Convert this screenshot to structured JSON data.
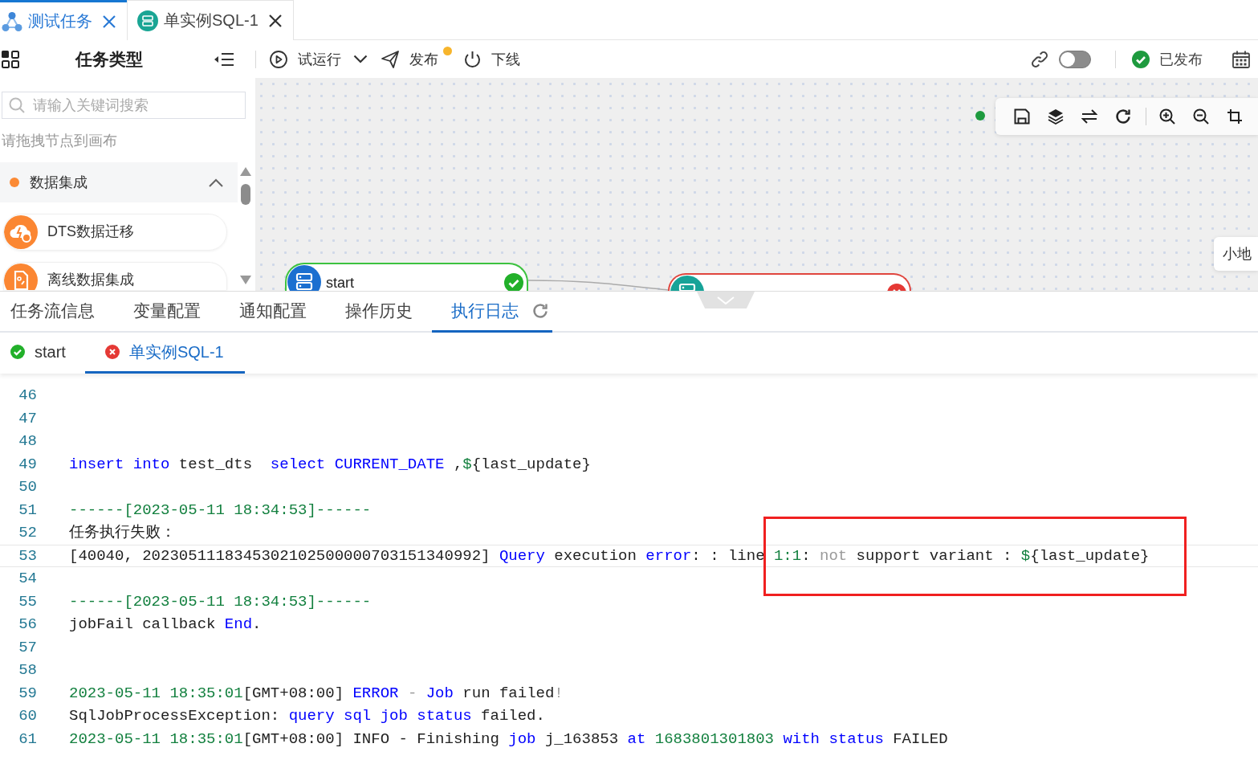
{
  "tabs": [
    {
      "label": "测试任务",
      "kind": "flow",
      "selected": true
    },
    {
      "label": "单实例SQL-1",
      "kind": "sql",
      "selected": false
    }
  ],
  "toolbar": {
    "title": "任务类型",
    "actions": [
      {
        "label": "试运行",
        "kind": "run",
        "dropdown": true,
        "dot": false
      },
      {
        "label": "发布",
        "kind": "publish",
        "dropdown": false,
        "dot": true
      },
      {
        "label": "下线",
        "kind": "offline",
        "dropdown": false,
        "dot": false
      }
    ],
    "toggle": {
      "on": false
    },
    "status": {
      "label": "已发布",
      "kind": "published"
    }
  },
  "sidebar": {
    "search": {
      "placeholder": "请输入关键词搜索"
    },
    "hint": "请拖拽节点到画布",
    "categories": [
      {
        "label": "数据集成",
        "expanded": true,
        "items": [
          {
            "label": "DTS数据迁移",
            "kind": "dts"
          },
          {
            "label": "离线数据集成",
            "kind": "offline"
          }
        ]
      }
    ]
  },
  "canvas": {
    "nodes": [
      {
        "label": "start",
        "kind": "success"
      },
      {
        "kind": "failed"
      }
    ],
    "minimap": {
      "label": "小地"
    }
  },
  "panel": {
    "tabs": [
      {
        "label": "任务流信息",
        "selected": false,
        "refresh": false
      },
      {
        "label": "变量配置",
        "selected": false,
        "refresh": false
      },
      {
        "label": "通知配置",
        "selected": false,
        "refresh": false
      },
      {
        "label": "操作历史",
        "selected": false,
        "refresh": false
      },
      {
        "label": "执行日志",
        "selected": true,
        "refresh": true
      }
    ],
    "node_tabs": [
      {
        "label": "start",
        "kind": "success",
        "selected": false
      },
      {
        "label": "单实例SQL-1",
        "kind": "failed",
        "selected": true
      }
    ],
    "log": {
      "lines": [
        {
          "number": "46",
          "active": false
        },
        {
          "number": "47",
          "active": false
        },
        {
          "number": "48",
          "active": false
        },
        {
          "number": "49",
          "active": false,
          "tokens": [
            {
              "text": "insert into",
              "kind": "keyword"
            },
            {
              "text": " test_dts  ",
              "kind": "plain"
            },
            {
              "text": "select CURRENT_DATE",
              "kind": "keyword"
            },
            {
              "text": " ,",
              "kind": "plain"
            },
            {
              "text": "$",
              "kind": "literal"
            },
            {
              "text": "{last_update}",
              "kind": "plain"
            }
          ]
        },
        {
          "number": "50",
          "active": false
        },
        {
          "number": "51",
          "active": false,
          "tokens": [
            {
              "text": "------[2023-05-11 18:34:53]------",
              "kind": "literal"
            }
          ]
        },
        {
          "number": "52",
          "active": false,
          "tokens": [
            {
              "text": "任务执行失败：",
              "kind": "plain"
            }
          ]
        },
        {
          "number": "53",
          "active": true,
          "tokens": [
            {
              "text": "[40040, 2023051118345302102500000703151340992] ",
              "kind": "plain"
            },
            {
              "text": "Query",
              "kind": "keyword"
            },
            {
              "text": " execution ",
              "kind": "plain"
            },
            {
              "text": "error",
              "kind": "keyword"
            },
            {
              "text": ": : line ",
              "kind": "plain"
            },
            {
              "text": "1:1",
              "kind": "literal"
            },
            {
              "text": ": ",
              "kind": "plain"
            },
            {
              "text": "not",
              "kind": "muted"
            },
            {
              "text": " support variant : ",
              "kind": "plain"
            },
            {
              "text": "$",
              "kind": "literal"
            },
            {
              "text": "{last_update}",
              "kind": "plain"
            }
          ]
        },
        {
          "number": "54",
          "active": false
        },
        {
          "number": "55",
          "active": false,
          "tokens": [
            {
              "text": "------[2023-05-11 18:34:53]------",
              "kind": "literal"
            }
          ]
        },
        {
          "number": "56",
          "active": false,
          "tokens": [
            {
              "text": "jobFail callback ",
              "kind": "plain"
            },
            {
              "text": "End",
              "kind": "keyword"
            },
            {
              "text": ".",
              "kind": "plain"
            }
          ]
        },
        {
          "number": "57",
          "active": false
        },
        {
          "number": "58",
          "active": false
        },
        {
          "number": "59",
          "active": false,
          "tokens": [
            {
              "text": "2023-05-11 18:35:01",
              "kind": "literal"
            },
            {
              "text": "[GMT+08:00] ",
              "kind": "plain"
            },
            {
              "text": "ERROR",
              "kind": "keyword"
            },
            {
              "text": " - ",
              "kind": "muted"
            },
            {
              "text": "Job",
              "kind": "keyword"
            },
            {
              "text": " run failed",
              "kind": "plain"
            },
            {
              "text": "!",
              "kind": "muted"
            }
          ]
        },
        {
          "number": "60",
          "active": false,
          "tokens": [
            {
              "text": "SqlJobProcessException: ",
              "kind": "plain"
            },
            {
              "text": "query sql job status",
              "kind": "keyword"
            },
            {
              "text": " failed.",
              "kind": "plain"
            }
          ]
        },
        {
          "number": "61",
          "active": false,
          "tokens": [
            {
              "text": "2023-05-11 18:35:01",
              "kind": "literal"
            },
            {
              "text": "[GMT+08:00] INFO - Finishing ",
              "kind": "plain"
            },
            {
              "text": "job",
              "kind": "keyword"
            },
            {
              "text": " j_163853 ",
              "kind": "plain"
            },
            {
              "text": "at",
              "kind": "keyword"
            },
            {
              "text": " 1683801301803 ",
              "kind": "literal"
            },
            {
              "text": "with status",
              "kind": "keyword"
            },
            {
              "text": " FAILED",
              "kind": "plain"
            }
          ]
        }
      ]
    },
    "annotation": {
      "kind": "rectangle"
    }
  }
}
